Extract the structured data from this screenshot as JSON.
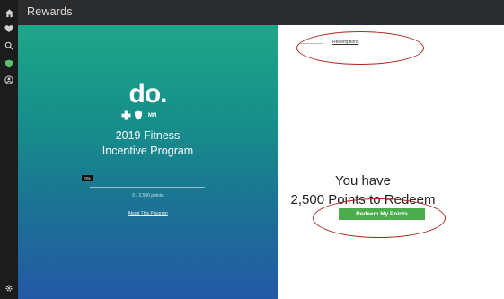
{
  "window": {
    "title": "Rewards"
  },
  "sidebar": {
    "icons": [
      "home-icon",
      "heart-icon",
      "search-icon",
      "shield-icon",
      "person-icon",
      "gear-icon"
    ]
  },
  "hero": {
    "logo": {
      "wordmark": "do.",
      "state": "MN"
    },
    "program_title_line1": "2019 Fitness",
    "program_title_line2": "Incentive Program",
    "progress": {
      "label": "0%",
      "value": 0
    },
    "points_caption": "0 / 2,500 points",
    "about_link": "About This Program"
  },
  "panel": {
    "tab_label": "Redemptions",
    "summary_line1": "You have",
    "summary_line2": "2,500 Points to Redeem",
    "redeem_button": "Redeem My Points"
  },
  "colors": {
    "annotation": "#b1261f",
    "button": "#4aac4b",
    "accent": "#1fa688"
  }
}
